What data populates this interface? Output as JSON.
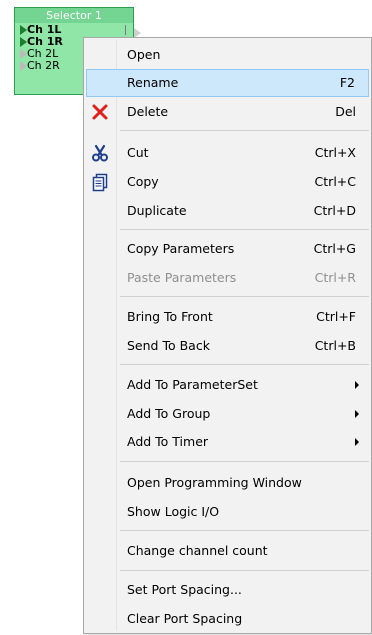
{
  "block": {
    "title": "Selector 1",
    "ports": [
      {
        "label": "Ch 1L",
        "active": true
      },
      {
        "label": "Ch 1R",
        "active": true
      },
      {
        "label": "Ch 2L",
        "active": false
      },
      {
        "label": "Ch 2R",
        "active": false
      }
    ]
  },
  "menu": {
    "items": [
      {
        "label": "Open",
        "shortcut": ""
      },
      {
        "label": "Rename",
        "shortcut": "F2",
        "state": "hover"
      },
      {
        "label": "Delete",
        "shortcut": "Del",
        "icon": "delete-x-icon"
      },
      {
        "label": "Cut",
        "shortcut": "Ctrl+X",
        "icon": "scissors-icon"
      },
      {
        "label": "Copy",
        "shortcut": "Ctrl+C",
        "icon": "copy-icon"
      },
      {
        "label": "Duplicate",
        "shortcut": "Ctrl+D"
      },
      {
        "label": "Copy Parameters",
        "shortcut": "Ctrl+G"
      },
      {
        "label": "Paste Parameters",
        "shortcut": "Ctrl+R",
        "state": "disabled"
      },
      {
        "label": "Bring To Front",
        "shortcut": "Ctrl+F"
      },
      {
        "label": "Send To Back",
        "shortcut": "Ctrl+B"
      },
      {
        "label": "Add To ParameterSet",
        "submenu": true
      },
      {
        "label": "Add To Group",
        "submenu": true
      },
      {
        "label": "Add To Timer",
        "submenu": true
      },
      {
        "label": "Open Programming Window",
        "shortcut": ""
      },
      {
        "label": "Show Logic I/O",
        "shortcut": ""
      },
      {
        "label": "Change channel count",
        "shortcut": ""
      },
      {
        "label": "Set Port Spacing...",
        "shortcut": ""
      },
      {
        "label": "Clear Port Spacing",
        "shortcut": ""
      }
    ]
  },
  "colors": {
    "block_fill": "#8fe6a6",
    "block_title": "#74d491",
    "hover_bg": "#cde8fb",
    "delete_icon": "#e0201b",
    "disabled_text": "#8f8f8f"
  }
}
